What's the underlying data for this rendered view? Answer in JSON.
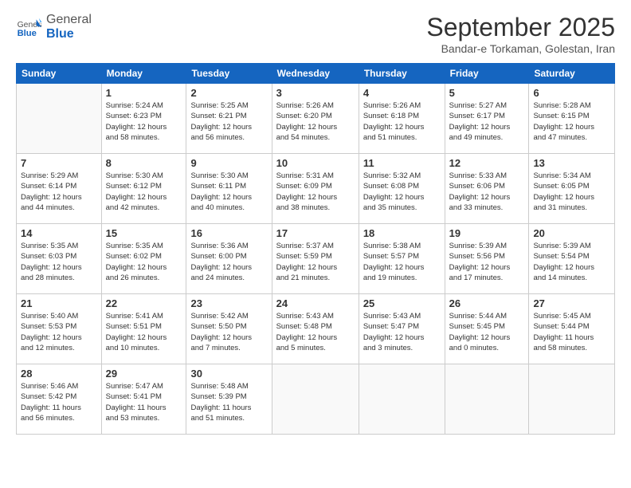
{
  "header": {
    "logo_line1": "General",
    "logo_line2": "Blue",
    "month": "September 2025",
    "location": "Bandar-e Torkaman, Golestan, Iran"
  },
  "days_of_week": [
    "Sunday",
    "Monday",
    "Tuesday",
    "Wednesday",
    "Thursday",
    "Friday",
    "Saturday"
  ],
  "weeks": [
    [
      {
        "day": "",
        "info": ""
      },
      {
        "day": "1",
        "info": "Sunrise: 5:24 AM\nSunset: 6:23 PM\nDaylight: 12 hours\nand 58 minutes."
      },
      {
        "day": "2",
        "info": "Sunrise: 5:25 AM\nSunset: 6:21 PM\nDaylight: 12 hours\nand 56 minutes."
      },
      {
        "day": "3",
        "info": "Sunrise: 5:26 AM\nSunset: 6:20 PM\nDaylight: 12 hours\nand 54 minutes."
      },
      {
        "day": "4",
        "info": "Sunrise: 5:26 AM\nSunset: 6:18 PM\nDaylight: 12 hours\nand 51 minutes."
      },
      {
        "day": "5",
        "info": "Sunrise: 5:27 AM\nSunset: 6:17 PM\nDaylight: 12 hours\nand 49 minutes."
      },
      {
        "day": "6",
        "info": "Sunrise: 5:28 AM\nSunset: 6:15 PM\nDaylight: 12 hours\nand 47 minutes."
      }
    ],
    [
      {
        "day": "7",
        "info": "Sunrise: 5:29 AM\nSunset: 6:14 PM\nDaylight: 12 hours\nand 44 minutes."
      },
      {
        "day": "8",
        "info": "Sunrise: 5:30 AM\nSunset: 6:12 PM\nDaylight: 12 hours\nand 42 minutes."
      },
      {
        "day": "9",
        "info": "Sunrise: 5:30 AM\nSunset: 6:11 PM\nDaylight: 12 hours\nand 40 minutes."
      },
      {
        "day": "10",
        "info": "Sunrise: 5:31 AM\nSunset: 6:09 PM\nDaylight: 12 hours\nand 38 minutes."
      },
      {
        "day": "11",
        "info": "Sunrise: 5:32 AM\nSunset: 6:08 PM\nDaylight: 12 hours\nand 35 minutes."
      },
      {
        "day": "12",
        "info": "Sunrise: 5:33 AM\nSunset: 6:06 PM\nDaylight: 12 hours\nand 33 minutes."
      },
      {
        "day": "13",
        "info": "Sunrise: 5:34 AM\nSunset: 6:05 PM\nDaylight: 12 hours\nand 31 minutes."
      }
    ],
    [
      {
        "day": "14",
        "info": "Sunrise: 5:35 AM\nSunset: 6:03 PM\nDaylight: 12 hours\nand 28 minutes."
      },
      {
        "day": "15",
        "info": "Sunrise: 5:35 AM\nSunset: 6:02 PM\nDaylight: 12 hours\nand 26 minutes."
      },
      {
        "day": "16",
        "info": "Sunrise: 5:36 AM\nSunset: 6:00 PM\nDaylight: 12 hours\nand 24 minutes."
      },
      {
        "day": "17",
        "info": "Sunrise: 5:37 AM\nSunset: 5:59 PM\nDaylight: 12 hours\nand 21 minutes."
      },
      {
        "day": "18",
        "info": "Sunrise: 5:38 AM\nSunset: 5:57 PM\nDaylight: 12 hours\nand 19 minutes."
      },
      {
        "day": "19",
        "info": "Sunrise: 5:39 AM\nSunset: 5:56 PM\nDaylight: 12 hours\nand 17 minutes."
      },
      {
        "day": "20",
        "info": "Sunrise: 5:39 AM\nSunset: 5:54 PM\nDaylight: 12 hours\nand 14 minutes."
      }
    ],
    [
      {
        "day": "21",
        "info": "Sunrise: 5:40 AM\nSunset: 5:53 PM\nDaylight: 12 hours\nand 12 minutes."
      },
      {
        "day": "22",
        "info": "Sunrise: 5:41 AM\nSunset: 5:51 PM\nDaylight: 12 hours\nand 10 minutes."
      },
      {
        "day": "23",
        "info": "Sunrise: 5:42 AM\nSunset: 5:50 PM\nDaylight: 12 hours\nand 7 minutes."
      },
      {
        "day": "24",
        "info": "Sunrise: 5:43 AM\nSunset: 5:48 PM\nDaylight: 12 hours\nand 5 minutes."
      },
      {
        "day": "25",
        "info": "Sunrise: 5:43 AM\nSunset: 5:47 PM\nDaylight: 12 hours\nand 3 minutes."
      },
      {
        "day": "26",
        "info": "Sunrise: 5:44 AM\nSunset: 5:45 PM\nDaylight: 12 hours\nand 0 minutes."
      },
      {
        "day": "27",
        "info": "Sunrise: 5:45 AM\nSunset: 5:44 PM\nDaylight: 11 hours\nand 58 minutes."
      }
    ],
    [
      {
        "day": "28",
        "info": "Sunrise: 5:46 AM\nSunset: 5:42 PM\nDaylight: 11 hours\nand 56 minutes."
      },
      {
        "day": "29",
        "info": "Sunrise: 5:47 AM\nSunset: 5:41 PM\nDaylight: 11 hours\nand 53 minutes."
      },
      {
        "day": "30",
        "info": "Sunrise: 5:48 AM\nSunset: 5:39 PM\nDaylight: 11 hours\nand 51 minutes."
      },
      {
        "day": "",
        "info": ""
      },
      {
        "day": "",
        "info": ""
      },
      {
        "day": "",
        "info": ""
      },
      {
        "day": "",
        "info": ""
      }
    ]
  ]
}
